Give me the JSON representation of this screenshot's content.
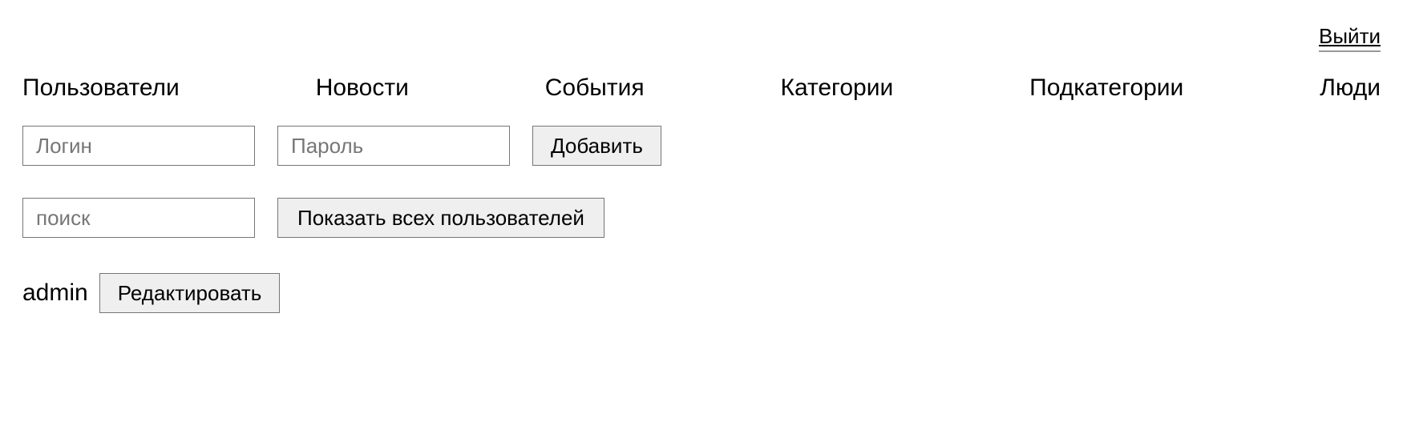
{
  "header": {
    "logout_label": "Выйти"
  },
  "nav": {
    "items": [
      {
        "label": "Пользователи"
      },
      {
        "label": "Новости"
      },
      {
        "label": "События"
      },
      {
        "label": "Категории"
      },
      {
        "label": "Подкатегории"
      },
      {
        "label": "Люди"
      }
    ]
  },
  "form": {
    "login_placeholder": "Логин",
    "password_placeholder": "Пароль",
    "add_label": "Добавить",
    "search_placeholder": "поиск",
    "show_all_label": "Показать всех пользователей"
  },
  "users": [
    {
      "name": "admin",
      "edit_label": "Редактировать"
    }
  ]
}
